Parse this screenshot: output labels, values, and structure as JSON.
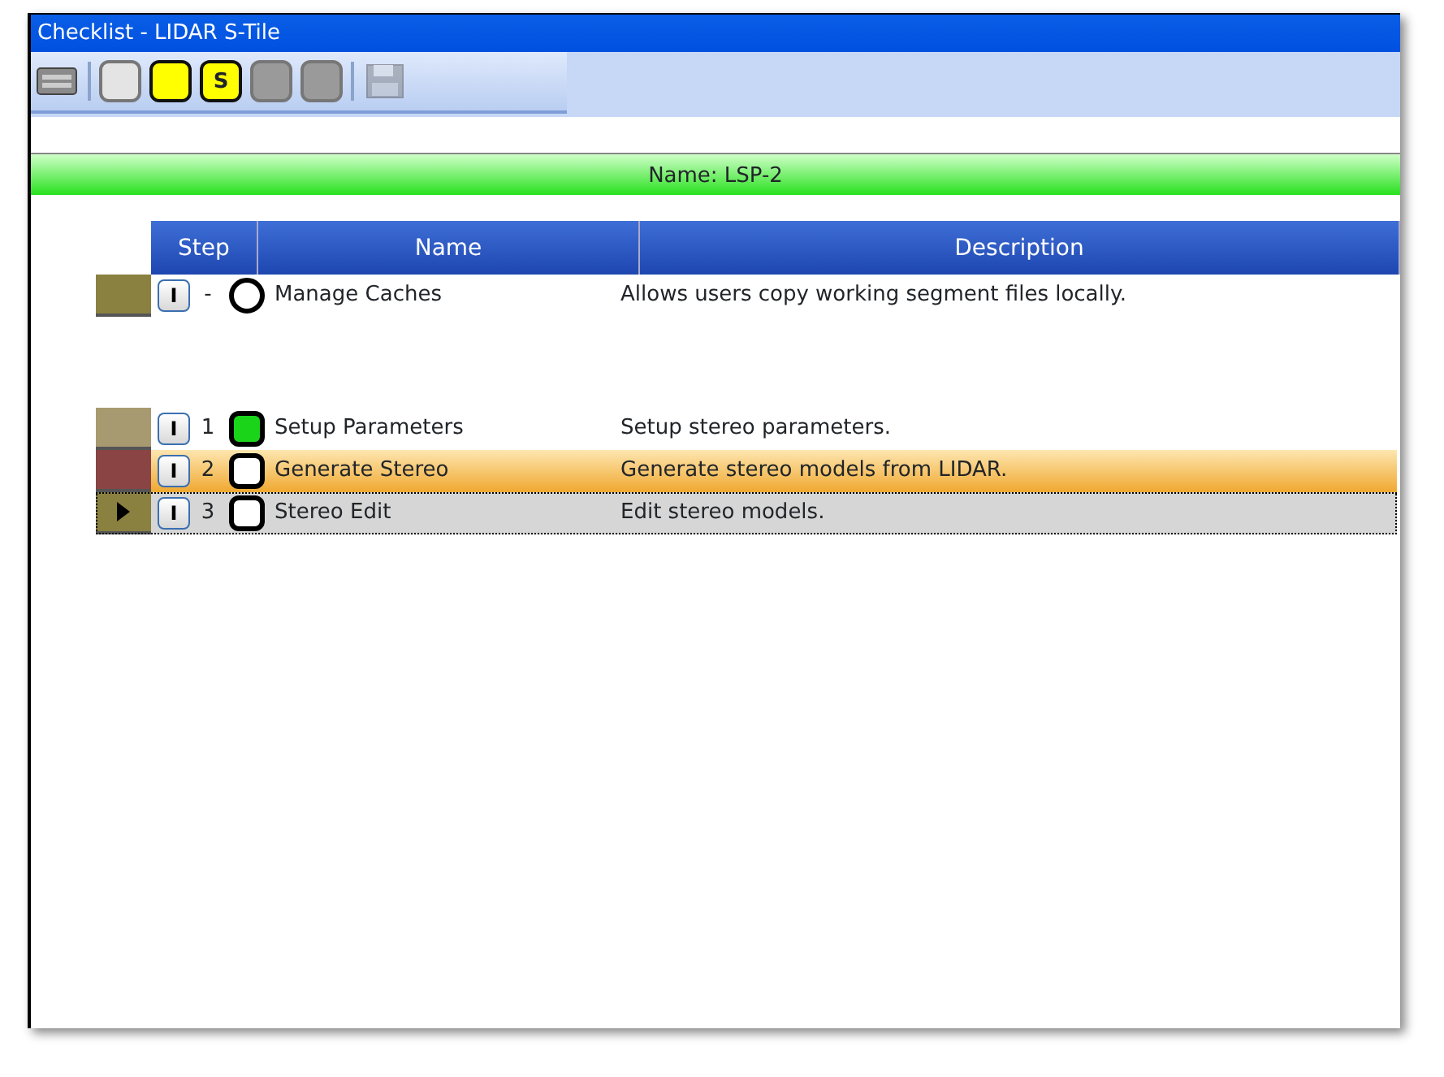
{
  "window": {
    "title": "Checklist - LIDAR S-Tile"
  },
  "toolbar": [
    {
      "kind": "device"
    },
    {
      "kind": "separator"
    },
    {
      "kind": "light"
    },
    {
      "kind": "yellow"
    },
    {
      "kind": "yellow",
      "label": "S"
    },
    {
      "kind": "grey"
    },
    {
      "kind": "grey"
    },
    {
      "kind": "separator"
    },
    {
      "kind": "save"
    }
  ],
  "name_bar": "Name: LSP-2",
  "table": {
    "columns": [
      "Step",
      "Name",
      "Description"
    ],
    "sections": [
      {
        "rows": [
          {
            "color": "#8a8040",
            "info": "I",
            "step": "-",
            "kind": "circle",
            "complete": false,
            "name": "Manage Caches",
            "description": "Allows users copy working segment files locally.",
            "highlighted": false,
            "selected": false
          }
        ]
      },
      {
        "rows": [
          {
            "color": "#a89a70",
            "info": "I",
            "step": "1",
            "kind": "square",
            "complete": true,
            "name": "Setup Parameters",
            "description": "Setup stereo parameters.",
            "highlighted": false,
            "selected": false
          },
          {
            "color": "#8a4444",
            "info": "I",
            "step": "2",
            "kind": "square",
            "complete": false,
            "name": "Generate Stereo",
            "description": "Generate stereo models from LIDAR.",
            "highlighted": true,
            "selected": false
          },
          {
            "color": "#8a8040",
            "info": "I",
            "step": "3",
            "kind": "square",
            "complete": false,
            "name": "Stereo Edit",
            "description": "Edit stereo models.",
            "highlighted": false,
            "selected": true
          }
        ]
      }
    ]
  }
}
